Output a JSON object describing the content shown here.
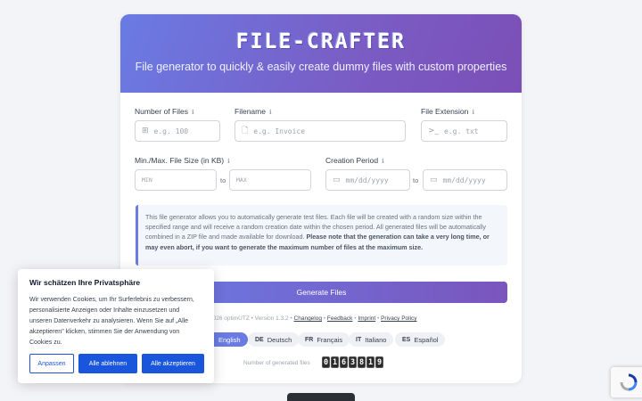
{
  "header": {
    "logo": "FILE-CRAFTER",
    "subtitle": "File generator to quickly & easily create dummy files with custom properties"
  },
  "form": {
    "num_files_label": "Number of Files",
    "num_files_placeholder": "e.g. 100",
    "filename_label": "Filename",
    "filename_placeholder": "e.g. Invoice",
    "ext_label": "File Extension",
    "ext_placeholder": "e.g. txt",
    "size_label": "Min./Max. File Size (in KB)",
    "min_placeholder": "MIN",
    "max_placeholder": "MAX",
    "to": "to",
    "period_label": "Creation Period",
    "date_placeholder": "mm/dd/yyyy"
  },
  "notice": {
    "text": "This file generator allows you to automatically generate test files. Each file will be created with a random size within the specified range and will receive a random creation date within the chosen period. All generated files will be automatically combined in a ZIP file and made available for download.",
    "bold": "Please note that the generation can take a very long time, or may even abort, if you want to generate the maximum number of files at the maximum size."
  },
  "generate_button": "Generate Files",
  "footer": {
    "copyright": "2026 optimUTZ • Version 1.3.2 •",
    "links": [
      "Changelog",
      "Feedback",
      "Imprint",
      "Privacy Policy"
    ]
  },
  "languages": [
    {
      "code": "",
      "label": "English",
      "active": true
    },
    {
      "code": "DE",
      "label": "Deutsch"
    },
    {
      "code": "FR",
      "label": "Français"
    },
    {
      "code": "IT",
      "label": "Italiano"
    },
    {
      "code": "ES",
      "label": "Español"
    }
  ],
  "counter": {
    "label": "Number of generated files",
    "digits": [
      "0",
      "1",
      "6",
      "3",
      "8",
      "1",
      "9"
    ]
  },
  "cookie": {
    "title": "Wir schätzen Ihre Privatsphäre",
    "text": "Wir verwenden Cookies, um Ihr Surferlebnis zu verbessern, personalisierte Anzeigen oder Inhalte einzusetzen und unseren Datenverkehr zu analysieren. Wenn Sie auf „Alle akzeptieren\" klicken, stimmen Sie der Anwendung von Cookies zu.",
    "customize": "Anpassen",
    "reject": "Alle ablehnen",
    "accept": "Alle akzeptieren"
  },
  "colors": {
    "accent": "#6a7be4",
    "cookie_primary": "#1a56db"
  }
}
